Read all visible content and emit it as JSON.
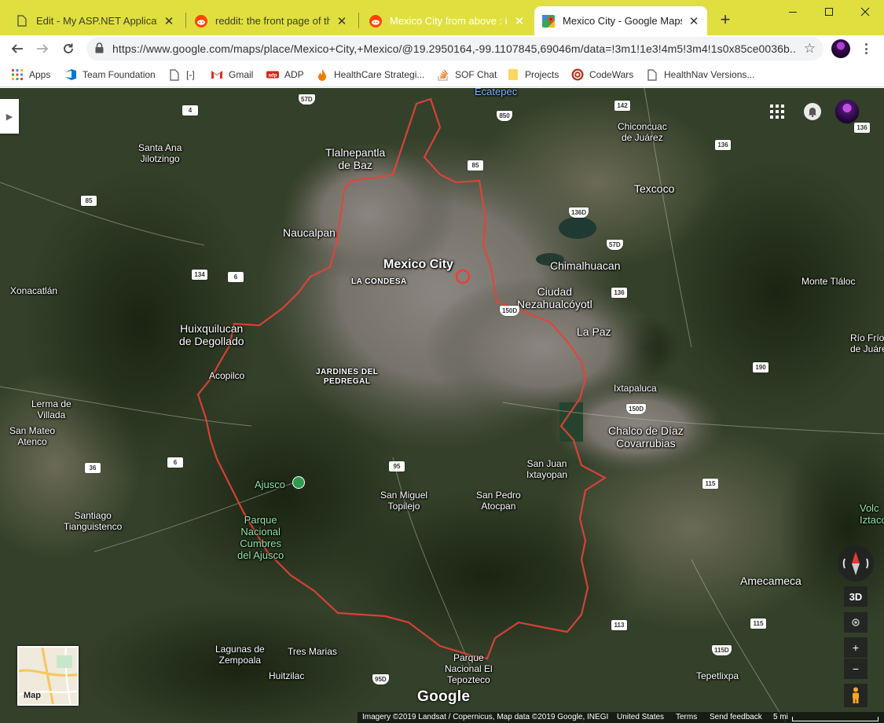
{
  "browser": {
    "tabs": [
      {
        "title": "Edit - My ASP.NET Application",
        "icon": "document-icon",
        "active": false
      },
      {
        "title": "reddit: the front page of the internet",
        "icon": "reddit-icon",
        "active": false
      },
      {
        "title": "Mexico City from above : interestingasfuck",
        "icon": "reddit-icon",
        "active": false
      },
      {
        "title": "Mexico City - Google Maps",
        "icon": "google-maps-icon",
        "active": true
      }
    ],
    "new_tab": "+",
    "url": "https://www.google.com/maps/place/Mexico+City,+Mexico/@19.2950164,-99.1107845,69046m/data=!3m1!1e3!4m5!3m4!1s0x85ce0036b...",
    "bookmarks": [
      {
        "label": "Apps",
        "icon": "apps-grid-icon"
      },
      {
        "label": "Team Foundation",
        "icon": "team-foundation-icon"
      },
      {
        "label": "[-]",
        "icon": "document-icon"
      },
      {
        "label": "Gmail",
        "icon": "gmail-icon"
      },
      {
        "label": "ADP",
        "icon": "adp-icon"
      },
      {
        "label": "HealthCare Strategi...",
        "icon": "flame-icon"
      },
      {
        "label": "SOF Chat",
        "icon": "stackoverflow-icon"
      },
      {
        "label": "Projects",
        "icon": "folder-icon"
      },
      {
        "label": "CodeWars",
        "icon": "codewars-icon"
      },
      {
        "label": "HealthNav Versions...",
        "icon": "document-icon"
      }
    ]
  },
  "map": {
    "labels": {
      "ecatepec": "Ecatepec",
      "tlalnepantla": "Tlalnepantla\nde Baz",
      "santa_ana": "Santa Ana\nJilotzingo",
      "chiconcuac": "Chiconcuac\nde Juárez",
      "texcoco": "Texcoco",
      "naucalpan": "Naucalpan",
      "mexico_city": "Mexico City",
      "la_condesa": "LA CONDESA",
      "chimalhuacan": "Chimalhuacan",
      "nezahualcoyotl": "Ciudad\nNezahualcóyotl",
      "monte_tlaloc": "Monte Tláloc",
      "xonacatlan": "Xonacatlán",
      "huixquilucan": "Huixquilucan\nde Degollado",
      "la_paz": "La Paz",
      "rio_frio": "Río Frío\nde Juáre",
      "jardines": "JARDINES DEL\nPEDREGAL",
      "acopilco": "Acopilco",
      "ixtapaluca": "Ixtapaluca",
      "lerma": "Lerma de\nVillada",
      "chalco": "Chalco de Díaz\nCovarrubias",
      "san_mateo": "San Mateo\nAtenco",
      "san_juan": "San Juan\nIxtayopan",
      "ajusco": "Ajusco",
      "san_miguel": "San Miguel\nTopilejo",
      "san_pedro": "San Pedro\nAtocpan",
      "santiago": "Santiago\nTianguistenco",
      "volcan": "Volc\nIztacchu",
      "parque_ajusco": "Parque\nNacional\nCumbres\ndel Ajusco",
      "amecameca": "Amecameca",
      "lagunas": "Lagunas de\nZempoala",
      "tres_marias": "Tres Marias",
      "parque_tepozteco": "Parque\nNacional El\nTepozteco",
      "huitzilac": "Huitzilac",
      "tepetlixpa": "Tepetlixpa"
    },
    "route_shields": [
      "4",
      "57D",
      "850",
      "142",
      "85",
      "136",
      "136D",
      "85",
      "57D",
      "134",
      "6",
      "136",
      "150D",
      "190",
      "150D",
      "6",
      "36",
      "95",
      "115",
      "113",
      "115",
      "95D",
      "115D",
      "136"
    ],
    "controls": {
      "three_d": "3D",
      "zoom_in": "+",
      "zoom_out": "−"
    },
    "minimap_label": "Map",
    "logo": "Google",
    "footer": {
      "attribution": "Imagery ©2019 Landsat / Copernicus, Map data ©2019 Google, INEGI",
      "country": "United States",
      "terms": "Terms",
      "feedback": "Send feedback",
      "scale": "5 mi"
    },
    "colors": {
      "boundary": "#e8413a",
      "tabstrip": "#dfe040"
    }
  }
}
